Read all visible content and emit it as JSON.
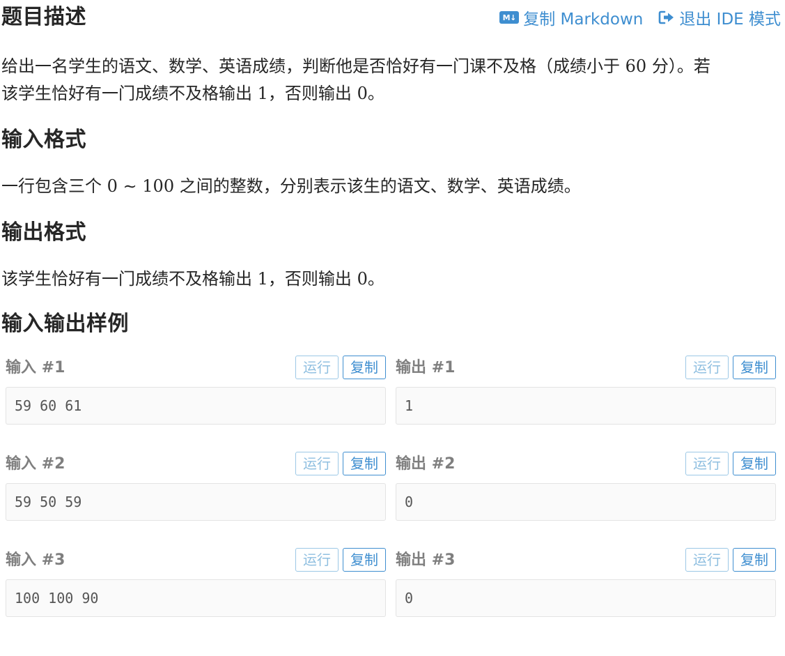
{
  "header": {
    "title": "题目描述",
    "copy_markdown": "复制 Markdown",
    "exit_ide": "退出 IDE 模式",
    "accent_color": "#3e8ed0"
  },
  "description": {
    "line1_a": "给出一名学生的语文、数学、英语成绩，判断他是否恰好有一门课不及格（成绩小于 ",
    "line1_num": "60",
    "line1_b": " 分）。若",
    "line2_a": "该学生恰好有一门成绩不及格输出 ",
    "line2_num1": "1",
    "line2_b": "，否则输出 ",
    "line2_num2": "0",
    "line2_c": "。"
  },
  "input_format": {
    "title": "输入格式",
    "text_a": "一行包含三个 ",
    "num_a": "0 ∼ 100",
    "text_b": " 之间的整数，分别表示该生的语文、数学、英语成绩。"
  },
  "output_format": {
    "title": "输出格式",
    "text_a": "该学生恰好有一门成绩不及格输出 ",
    "num_a": "1",
    "text_b": "，否则输出 ",
    "num_b": "0",
    "text_c": "。"
  },
  "samples": {
    "title": "输入输出样例",
    "run_label": "运行",
    "copy_label": "复制",
    "items": [
      {
        "input_title": "输入 #1",
        "input": "59 60 61",
        "output_title": "输出 #1",
        "output": "1"
      },
      {
        "input_title": "输入 #2",
        "input": "59 50 59",
        "output_title": "输出 #2",
        "output": "0"
      },
      {
        "input_title": "输入 #3",
        "input": "100 100 90",
        "output_title": "输出 #3",
        "output": "0"
      }
    ]
  }
}
